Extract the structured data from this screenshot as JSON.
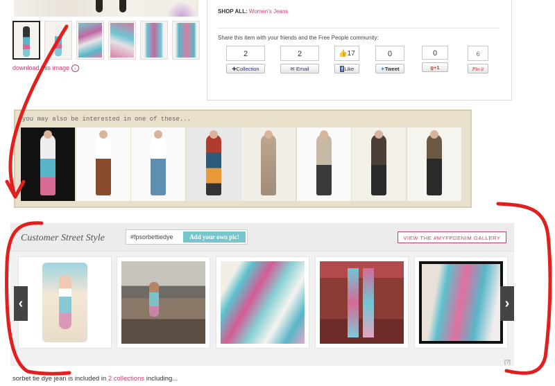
{
  "product": {
    "shop_all_label": "SHOP ALL:",
    "shop_all_link": "Women's Jeans",
    "download_label": "download this image",
    "thumb_count": 6
  },
  "share": {
    "prompt": "Share this item with your friends and the Free People community:",
    "buttons": [
      {
        "count": "2",
        "label": "Collection",
        "icon": "plus-icon"
      },
      {
        "count": "2",
        "label": "Email",
        "icon": "envelope-icon"
      },
      {
        "count": "17",
        "label": "Like",
        "icon": "facebook-like-icon"
      },
      {
        "count": "0",
        "label": "Tweet",
        "icon": "twitter-icon"
      },
      {
        "count": "0",
        "label": "+1",
        "icon": "google-plus-icon"
      },
      {
        "count": "6",
        "label": "Pin it",
        "icon": "pinterest-icon"
      }
    ]
  },
  "interest": {
    "title": "you may also be interested in one of these...",
    "items": 8
  },
  "street_style": {
    "title": "Customer Street Style",
    "hashtag": "#fpsorbettiedye",
    "add_pic_label": "Add your own pic!",
    "gallery_label": "VIEW THE #MYFPDENIM GALLERY",
    "prev_label": "‹",
    "next_label": "›",
    "help_label": "[?]"
  },
  "footer": {
    "text_before": "sorbet tie dye jean is included in ",
    "link": "2 collections",
    "text_after": " including..."
  },
  "colors": {
    "accent_pink": "#c2407a",
    "annotation_red": "#e0201e",
    "add_pic_teal": "#77c6ce"
  }
}
